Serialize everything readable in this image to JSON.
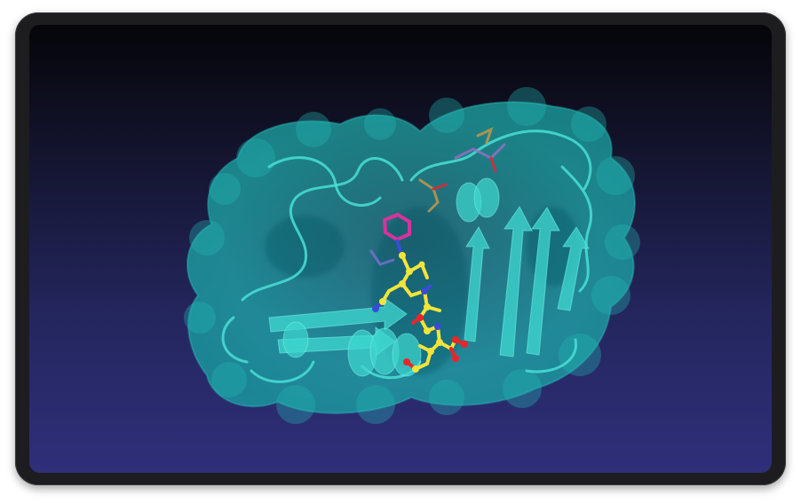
{
  "image": {
    "subject": "protein-ribbon-with-transparent-surface-and-ligand",
    "colors": {
      "background_top": "#050509",
      "background_bottom": "#2f2f7a",
      "surface": "#1fb3b0",
      "ribbon": "#3fd8d0",
      "ligand_carbon": "#f2e43a",
      "ligand_oxygen": "#e8262a",
      "ligand_nitrogen": "#3a4bd8",
      "side_chain": "#c2319a",
      "frame": "#1d1d1f"
    }
  }
}
